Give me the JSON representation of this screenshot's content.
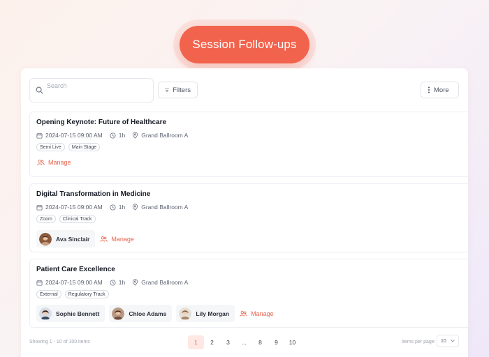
{
  "header": {
    "title": "Session Follow-ups"
  },
  "toolbar": {
    "search_placeholder": "Search",
    "filters_label": "Filters",
    "more_label": "More"
  },
  "sessions": [
    {
      "title": "Opening Keynote: Future of Healthcare",
      "datetime": "2024-07-15 09:00 AM",
      "duration": "1h",
      "location": "Grand Ballroom A",
      "tags": [
        "Semi Live",
        "Main Stage"
      ],
      "speakers": [],
      "manage_label": "Manage"
    },
    {
      "title": "Digital Transformation in Medicine",
      "datetime": "2024-07-15 09:00 AM",
      "duration": "1h",
      "location": "Grand Ballroom A",
      "tags": [
        "Zoom",
        "Clinical Track"
      ],
      "speakers": [
        "Ava Sinclair"
      ],
      "manage_label": "Manage"
    },
    {
      "title": "Patient Care Excellence",
      "datetime": "2024-07-15 09:00 AM",
      "duration": "1h",
      "location": "Grand Ballroom A",
      "tags": [
        "External",
        "Regulatory Track"
      ],
      "speakers": [
        "Sophie Bennett",
        "Chloe Adams",
        "Lily Morgan"
      ],
      "manage_label": "Manage"
    }
  ],
  "pagination": {
    "showing": "Showing 1 - 10 of 100 items",
    "pages": [
      "1",
      "2",
      "3",
      "...",
      "8",
      "9",
      "10"
    ],
    "active_page": "1",
    "per_page_label": "Items per page:",
    "per_page_value": "10"
  },
  "colors": {
    "accent": "#f1634d",
    "link": "#e8654f"
  }
}
